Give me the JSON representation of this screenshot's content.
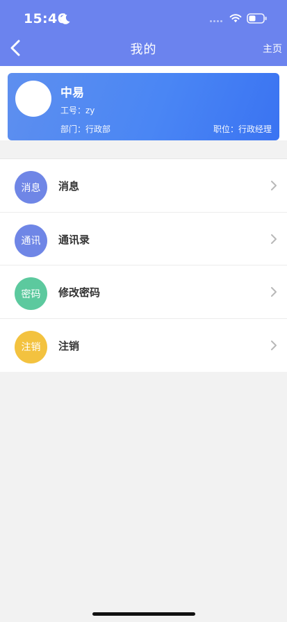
{
  "status_bar": {
    "time": "15:46",
    "icons": [
      "moon-icon",
      "signal-dots-icon",
      "wifi-icon",
      "battery-icon"
    ]
  },
  "nav": {
    "title": "我的",
    "right_link": "主页",
    "back_icon": "chevron-left-icon"
  },
  "profile": {
    "name": "中易",
    "employee_id": "工号：zy",
    "department": "部门：行政部",
    "position": "职位：行政经理"
  },
  "menu": {
    "items": [
      {
        "icon_text": "消息",
        "label": "消息",
        "color": "#6f86e6"
      },
      {
        "icon_text": "通讯",
        "label": "通讯录",
        "color": "#6f86e6"
      },
      {
        "icon_text": "密码",
        "label": "修改密码",
        "color": "#5cc99e"
      },
      {
        "icon_text": "注销",
        "label": "注销",
        "color": "#f3c23f"
      }
    ]
  },
  "colors": {
    "header": "#6b83ee",
    "card_gradient_start": "#5e8fef",
    "card_gradient_end": "#3a73f2",
    "background": "#f2f2f2"
  }
}
